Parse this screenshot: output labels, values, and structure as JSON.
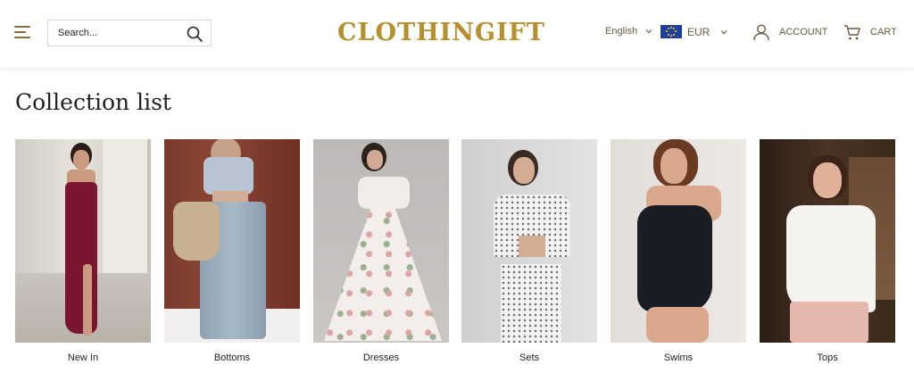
{
  "header": {
    "search_placeholder": "Search...",
    "logo": "CLOTHINGIFT",
    "language": "English",
    "currency": "EUR",
    "account_label": "ACCOUNT",
    "cart_label": "CART"
  },
  "page": {
    "title": "Collection list"
  },
  "collections": [
    {
      "label": "New In",
      "image": "woman-in-burgundy-strapless-dress"
    },
    {
      "label": "Bottoms",
      "image": "woman-in-wide-leg-jeans"
    },
    {
      "label": "Dresses",
      "image": "woman-in-floral-gown"
    },
    {
      "label": "Sets",
      "image": "woman-in-polka-dot-set"
    },
    {
      "label": "Swims",
      "image": "woman-in-black-swimsuit"
    },
    {
      "label": "Tops",
      "image": "woman-in-white-halter-top"
    }
  ],
  "colors": {
    "brand_gold": "#b5902d",
    "header_text": "#6b5a3e"
  },
  "icons": [
    "menu-icon",
    "search-icon",
    "chevron-down-icon",
    "eu-flag-icon",
    "user-icon",
    "cart-icon"
  ]
}
